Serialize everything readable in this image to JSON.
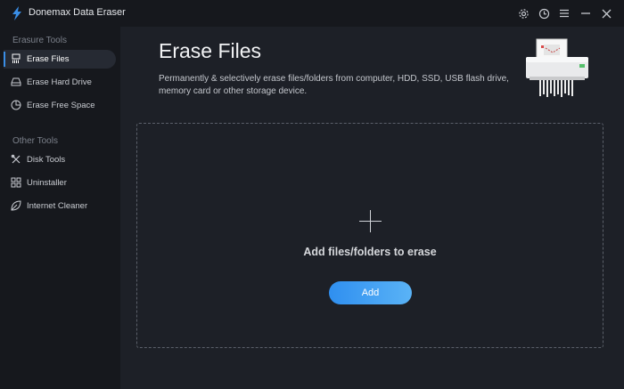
{
  "app": {
    "title": "Donemax Data Eraser"
  },
  "titlebar": {
    "icons": [
      "gear-icon",
      "history-icon",
      "menu-icon",
      "minimize-icon",
      "close-icon"
    ]
  },
  "sidebar": {
    "sections": [
      {
        "title": "Erasure Tools",
        "items": [
          {
            "label": "Erase Files",
            "icon": "file-shred-icon",
            "active": true
          },
          {
            "label": "Erase Hard Drive",
            "icon": "hard-drive-icon",
            "active": false
          },
          {
            "label": "Erase Free Space",
            "icon": "pie-chart-icon",
            "active": false
          }
        ]
      },
      {
        "title": "Other Tools",
        "items": [
          {
            "label": "Disk Tools",
            "icon": "tools-icon",
            "active": false
          },
          {
            "label": "Uninstaller",
            "icon": "grid-icon",
            "active": false
          },
          {
            "label": "Internet Cleaner",
            "icon": "leaf-icon",
            "active": false
          }
        ]
      }
    ]
  },
  "main": {
    "title": "Erase Files",
    "description": "Permanently & selectively erase files/folders from computer, HDD, SSD, USB flash drive, memory card or other storage device.",
    "dropzone": {
      "text": "Add files/folders to erase",
      "button": "Add"
    }
  },
  "colors": {
    "accent": "#3a8ee6",
    "button_start": "#2f8ff0",
    "button_end": "#5ab3f6",
    "background": "#1d2027",
    "sidebar": "#16181d"
  }
}
